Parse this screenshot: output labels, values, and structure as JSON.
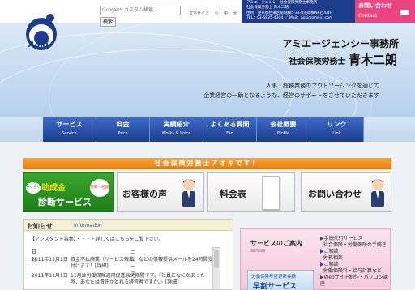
{
  "logo": {
    "text": "Aoki"
  },
  "search": {
    "placeholder": "Google™ カスタム検索",
    "button": "検索"
  },
  "fontsize": {
    "label": "文字サイズ",
    "small": "小",
    "medium": "中",
    "large": "大"
  },
  "topinfo": {
    "line1": "アミエージェンシー社会保険労務士事務所",
    "line2": "社会保険労務士 青木二朗",
    "line3": "住所：東京都台東区菊堀橋5-33-8浅草橋NKビル4F",
    "line4": "TEL：03-5825-4304 ／ Mail：aoki@ami-sr.com"
  },
  "contact": {
    "jp": "お問い合わせ",
    "en": "Contact"
  },
  "header": {
    "office": "アミエージェンシー事務所",
    "title_prefix": "社会保険労務士",
    "person": "青木二朗",
    "tagline1": "人事・総務業務のアウトソーシングを通じて",
    "tagline2": "企業経営の一助となるような、経営のサポートをさせていただきます"
  },
  "nav": [
    {
      "jp": "サービス",
      "en": "Service"
    },
    {
      "jp": "料金",
      "en": "Price"
    },
    {
      "jp": "実績紹介",
      "en": "Works & Voice"
    },
    {
      "jp": "よくある質問",
      "en": "Faq"
    },
    {
      "jp": "会社概要",
      "en": "Profile"
    },
    {
      "jp": "リンク",
      "en": "Link"
    }
  ],
  "banner_strip": "社会保険労務士アオキです！",
  "cards": {
    "grant": {
      "badge": "らくらく",
      "line1": "助成金",
      "line2": "診断サービス",
      "badge2": "診断・相談"
    },
    "voice": "お客様の声",
    "price": "料金表",
    "contact": "お問い合わせ"
  },
  "news": {
    "title": "お知らせ",
    "subtitle": "Information",
    "assist": "【アシスタント募集】・・・・詳しくはこちらをご覧下さい。",
    "col_date": "日付",
    "col_news": "ニュース",
    "rows": [
      {
        "date": "2011年11月1日",
        "text": "資金不払廃業（サービス残業）などの情報提供メールを24時間受付けます！[詳細]"
      },
      {
        "date": "2011年11月1日",
        "text": "11月は労働保険適用促進強化期間です。『社員になにかあった時、あなたは責任がとれる経営者ですか。』[詳細]"
      }
    ]
  },
  "service": {
    "title": "サービスのご案内",
    "subtitle": "Service",
    "items": [
      "手続代行サービス",
      "社会保険・労働保険の手続き",
      "ご相談",
      "労務相談",
      "ご相談",
      "労働保険料・給与計算など",
      "Webサイト制作・パソコン講座"
    ],
    "banner_line1": "労働保険年度更新業務",
    "banner_line2": "早割サービス"
  }
}
